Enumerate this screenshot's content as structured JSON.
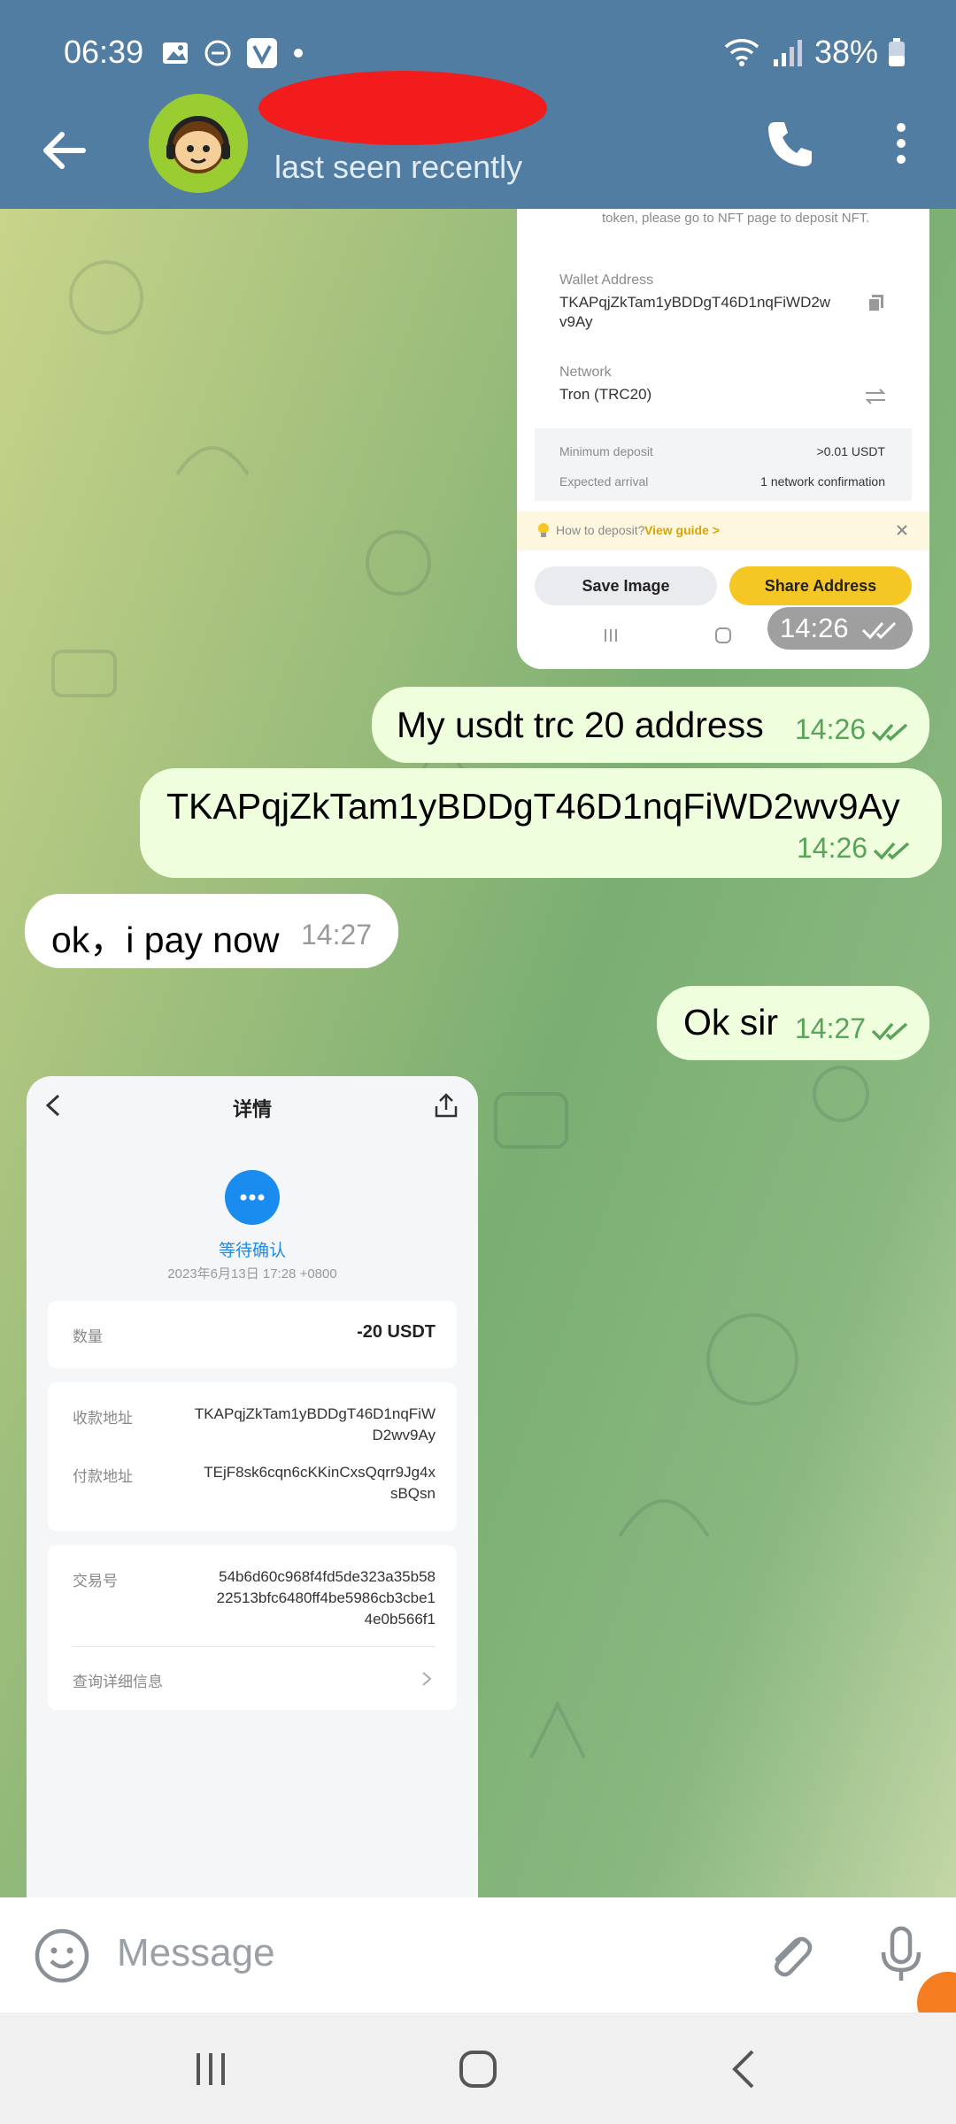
{
  "status": {
    "time": "06:39",
    "battery": "38%"
  },
  "header": {
    "last_seen": "last seen recently"
  },
  "screenshot1": {
    "deposit_note": "token, please go to NFT page to deposit NFT.",
    "wallet_address_label": "Wallet Address",
    "wallet_address_line1": "TKAPqjZkTam1yBDDgT46D1nqFiWD2w",
    "wallet_address_line2": "v9Ay",
    "network_label": "Network",
    "network_value": "Tron (TRC20)",
    "min_deposit_label": "Minimum deposit",
    "min_deposit_value": ">0.01 USDT",
    "expected_arrival_label": "Expected arrival",
    "expected_arrival_value": "1 network confirmation",
    "how_to_deposit": "How to deposit?",
    "view_guide": "View guide >",
    "save_image": "Save Image",
    "share_address": "Share Address",
    "time": "14:26"
  },
  "messages": [
    {
      "text": "My usdt trc 20 address",
      "time": "14:26"
    },
    {
      "text": "TKAPqjZkTam1yBDDgT46D1nqFiWD2wv9Ay",
      "time": "14:26"
    },
    {
      "text": "ok，i pay now",
      "time": "14:27"
    },
    {
      "text": "Ok sir",
      "time": "14:27"
    }
  ],
  "screenshot2": {
    "title": "详情",
    "status": "等待确认",
    "date": "2023年6月13日 17:28 +0800",
    "amount_label": "数量",
    "amount_value": "-20 USDT",
    "recv_label": "收款地址",
    "recv_line1": "TKAPqjZkTam1yBDDgT46D1nqFiW",
    "recv_line2": "D2wv9Ay",
    "pay_label": "付款地址",
    "pay_line1": "TEjF8sk6cqn6cKKinCxsQqrr9Jg4x",
    "pay_line2": "sBQsn",
    "tx_label": "交易号",
    "tx_line1": "54b6d60c968f4fd5de323a35b58",
    "tx_line2": "22513bfc6480ff4be5986cb3cbe1",
    "tx_line3": "4e0b566f1",
    "query_details": "查询详细信息"
  },
  "input": {
    "placeholder": "Message"
  },
  "colors": {
    "header": "#527da3",
    "outgoing_bubble": "#effedd",
    "tick": "#59a35a",
    "accent_yellow": "#f5c724"
  }
}
